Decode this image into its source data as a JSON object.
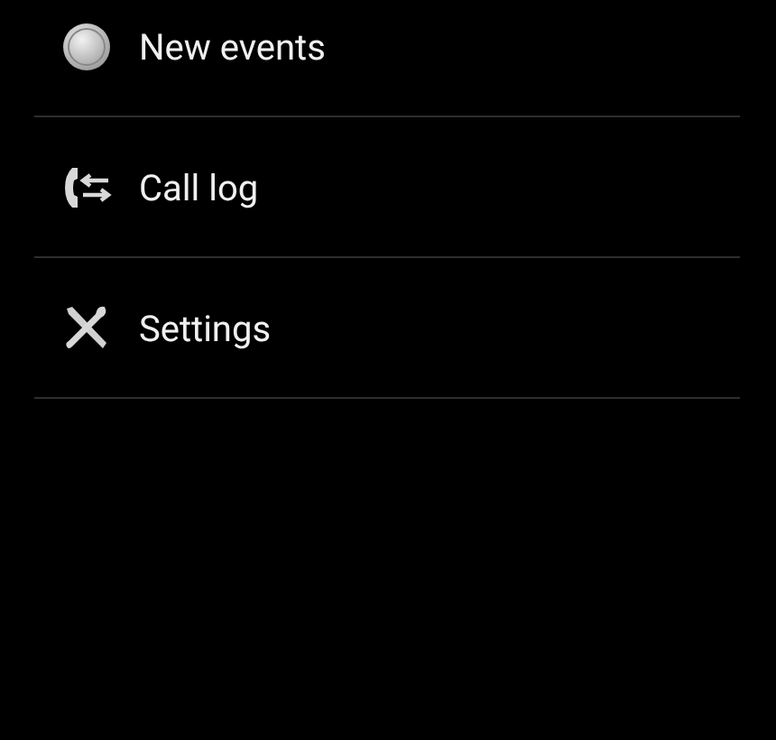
{
  "menu": {
    "items": [
      {
        "kind": "circle",
        "label": "New events"
      },
      {
        "kind": "call-log",
        "label": "Call log"
      },
      {
        "kind": "tools",
        "label": "Settings"
      }
    ]
  }
}
